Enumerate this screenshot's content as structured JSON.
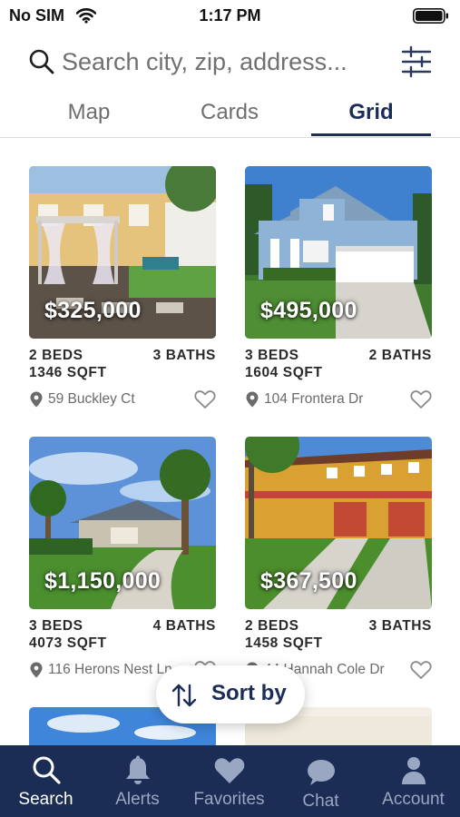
{
  "status_bar": {
    "carrier": "No SIM",
    "time": "1:17 PM"
  },
  "search": {
    "placeholder": "Search city, zip, address..."
  },
  "view_tabs": [
    {
      "label": "Map",
      "active": false
    },
    {
      "label": "Cards",
      "active": false
    },
    {
      "label": "Grid",
      "active": true
    }
  ],
  "listings": [
    {
      "price": "$325,000",
      "beds": "2 BEDS",
      "baths": "3 BATHS",
      "sqft": "1346 SQFT",
      "address": "59 Buckley Ct"
    },
    {
      "price": "$495,000",
      "beds": "3 BEDS",
      "baths": "2 BATHS",
      "sqft": "1604 SQFT",
      "address": "104 Frontera Dr"
    },
    {
      "price": "$1,150,000",
      "beds": "3 BEDS",
      "baths": "4 BATHS",
      "sqft": "4073 SQFT",
      "address": "116 Herons Nest Ln"
    },
    {
      "price": "$367,500",
      "beds": "2 BEDS",
      "baths": "3 BATHS",
      "sqft": "1458 SQFT",
      "address": "44 Hannah Cole Dr"
    }
  ],
  "sort": {
    "label": "Sort by"
  },
  "bottom_nav": [
    {
      "label": "Search",
      "icon": "search-icon",
      "active": true
    },
    {
      "label": "Alerts",
      "icon": "bell-icon",
      "active": false
    },
    {
      "label": "Favorites",
      "icon": "heart-icon",
      "active": false
    },
    {
      "label": "Chat",
      "icon": "chat-bubble-icon",
      "active": false
    },
    {
      "label": "Account",
      "icon": "person-icon",
      "active": false
    }
  ],
  "colors": {
    "brand_navy": "#1b2c55",
    "inactive_nav": "#9aa7c3",
    "muted_text": "#6b6b6b"
  }
}
